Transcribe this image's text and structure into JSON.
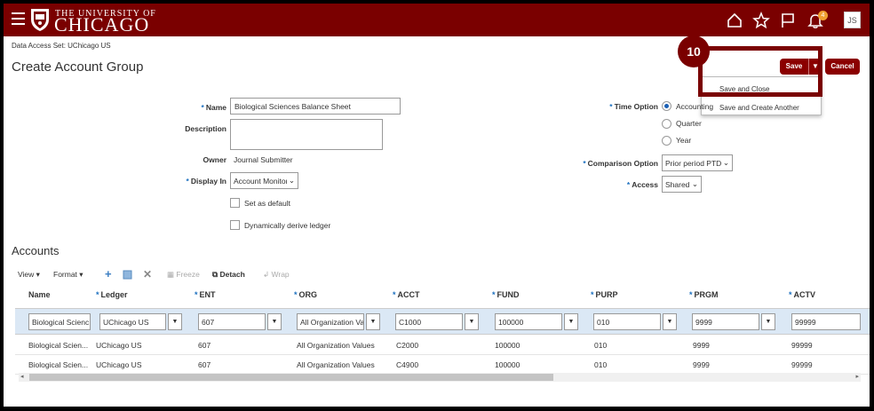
{
  "header": {
    "university_line1": "THE UNIVERSITY OF",
    "university_line2": "CHICAGO",
    "notification_count": "4",
    "user_initials": "JS"
  },
  "page": {
    "data_access": "Data Access Set: UChicago US",
    "title": "Create Account Group"
  },
  "actions": {
    "save": "Save",
    "cancel": "Cancel",
    "save_menu": [
      "Save and Close",
      "Save and Create Another"
    ],
    "callout_number": "10"
  },
  "form": {
    "name_label": "Name",
    "name_value": "Biological Sciences Balance Sheet",
    "description_label": "Description",
    "description_value": "",
    "owner_label": "Owner",
    "owner_value": "Journal Submitter",
    "display_in_label": "Display In",
    "display_in_value": "Account Monitor",
    "set_as_default": "Set as default",
    "dynamically_derive": "Dynamically derive ledger",
    "time_option_label": "Time Option",
    "time_options": [
      "Accounting",
      "Quarter",
      "Year"
    ],
    "time_option_selected": "Accounting",
    "comparison_label": "Comparison Option",
    "comparison_value": "Prior period PTD",
    "access_label": "Access",
    "access_value": "Shared"
  },
  "accounts": {
    "title": "Accounts",
    "toolbar": {
      "view": "View",
      "format": "Format",
      "freeze": "Freeze",
      "detach": "Detach",
      "wrap": "Wrap"
    },
    "columns": [
      "Name",
      "Ledger",
      "ENT",
      "ORG",
      "ACCT",
      "FUND",
      "PURP",
      "PRGM",
      "ACTV"
    ],
    "filter_row": [
      "Biological Scienc",
      "UChicago US",
      "607",
      "All Organization Va",
      "C1000",
      "100000",
      "010",
      "9999",
      "99999"
    ],
    "rows": [
      [
        "Biological Scien...",
        "UChicago US",
        "607",
        "All Organization Values",
        "C2000",
        "100000",
        "010",
        "9999",
        "99999"
      ],
      [
        "Biological Scien...",
        "UChicago US",
        "607",
        "All Organization Values",
        "C4900",
        "100000",
        "010",
        "9999",
        "99999"
      ]
    ]
  },
  "colors": {
    "brand": "#7a0000",
    "button": "#8b0000",
    "required": "#1a6fbf",
    "filter_row": "#dbe8f5"
  }
}
